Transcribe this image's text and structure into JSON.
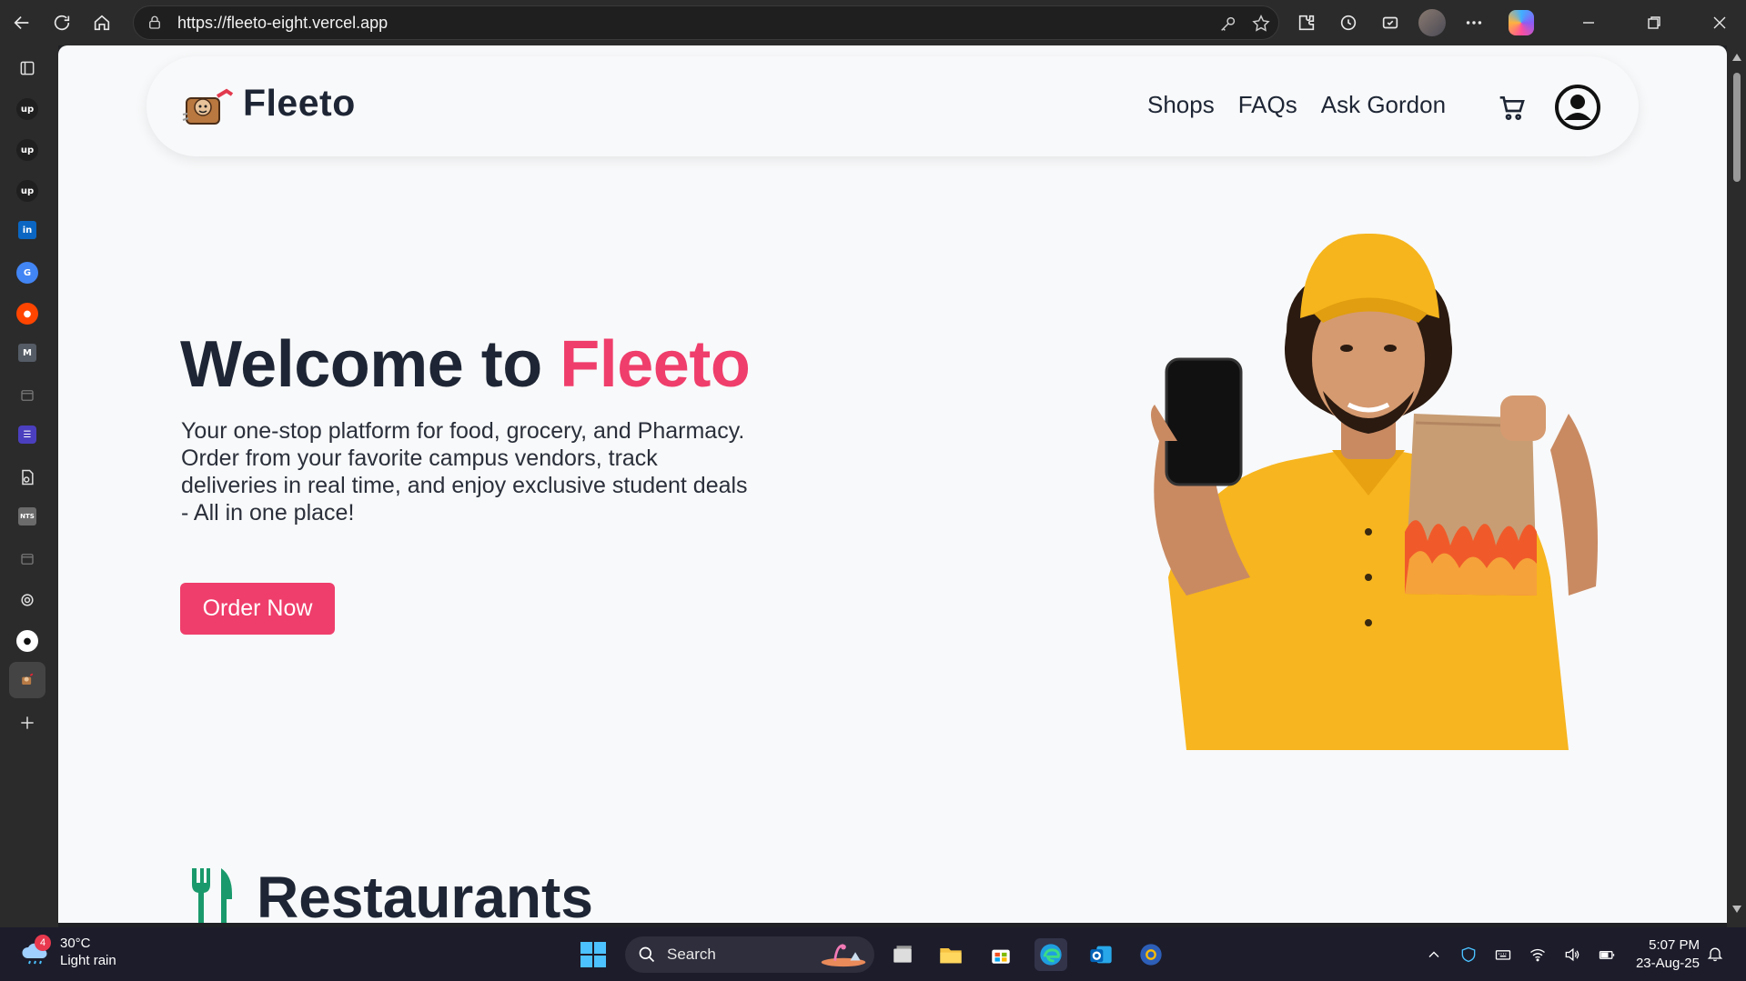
{
  "browser": {
    "url": "https://fleeto-eight.vercel.app"
  },
  "site": {
    "brand": "Fleeto",
    "nav": {
      "links": [
        "Shops",
        "FAQs",
        "Ask Gordon"
      ]
    },
    "hero": {
      "title_prefix": "Welcome to ",
      "title_accent": "Fleeto",
      "description": "Your one-stop platform for food, grocery, and Pharmacy. Order from your favorite campus vendors, track deliveries in real time, and enjoy exclusive student deals - All in one place!",
      "cta_label": "Order Now"
    },
    "restaurants": {
      "heading": "Restaurants"
    },
    "colors": {
      "accent": "#ef3e6b",
      "text_dark": "#1e2635",
      "background": "#f8f9fa",
      "restaurant_icon": "#1a9a6c"
    }
  },
  "taskbar": {
    "weather_badge": "4",
    "temperature": "30°C",
    "condition": "Light rain",
    "search_label": "Search",
    "time": "5:07 PM",
    "date": "23-Aug-25"
  }
}
